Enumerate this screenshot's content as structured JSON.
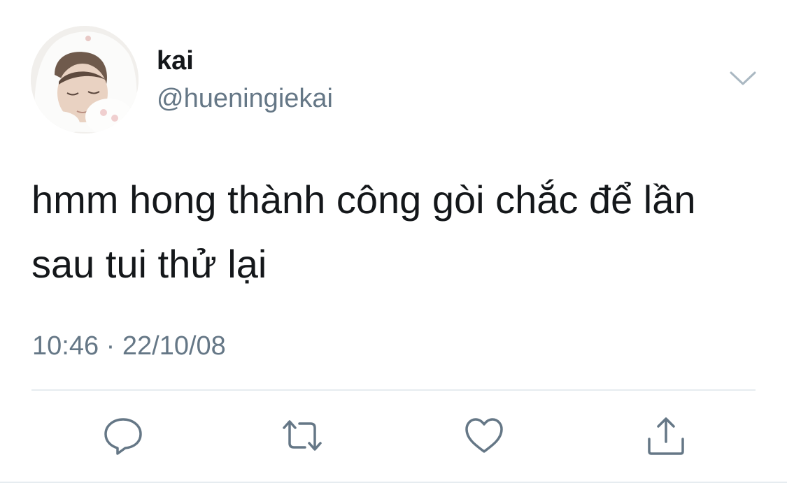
{
  "tweet": {
    "author": {
      "display_name": "kai",
      "handle": "@hueningiekai",
      "avatar": "avatar-photo"
    },
    "text": "hmm hong thành công gòi chắc để lần sau tui thử lại",
    "timestamp": "10:46 · 22/10/08",
    "menu_icon": "chevron-down-icon",
    "actions": [
      {
        "name": "reply",
        "icon": "reply-icon"
      },
      {
        "name": "retweet",
        "icon": "retweet-icon"
      },
      {
        "name": "like",
        "icon": "heart-icon"
      },
      {
        "name": "share",
        "icon": "share-icon"
      }
    ]
  },
  "colors": {
    "primary_text": "#14171a",
    "secondary_text": "#657786",
    "divider": "#e6ecf0",
    "icon": "#657786"
  }
}
